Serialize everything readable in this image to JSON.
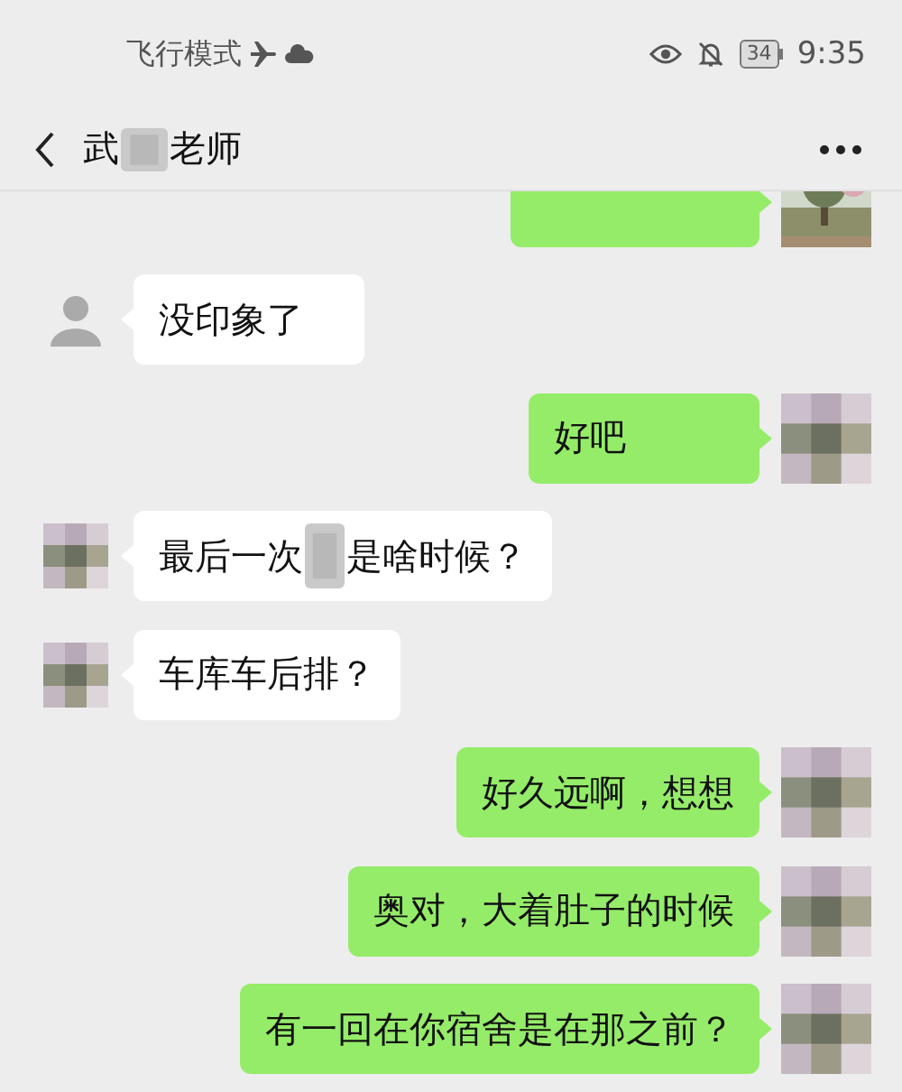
{
  "status_bar": {
    "mode_text": "飞行模式",
    "battery": "34",
    "time": "9:35"
  },
  "header": {
    "title_parts": [
      "武",
      "老师"
    ]
  },
  "messages": [
    {
      "kind": "sent"
    },
    {
      "kind": "received",
      "avatar": {
        "kind": "person"
      },
      "parts": [
        "没印象了"
      ]
    },
    {
      "kind": "sent",
      "avatar": {
        "kind": "blurred"
      },
      "parts": [
        "好吧"
      ]
    },
    {
      "kind": "received",
      "avatar": {
        "kind": "blurred"
      },
      "parts": [
        "最后一次",
        "是啥时候？"
      ]
    },
    {
      "kind": "received",
      "avatar": {
        "kind": "blurred"
      },
      "parts": [
        "车库车后排？"
      ]
    },
    {
      "kind": "sent",
      "avatar": {
        "kind": "blurred"
      },
      "parts": [
        "好久远啊，想想"
      ]
    },
    {
      "kind": "sent",
      "avatar": {
        "kind": "blurred"
      },
      "parts": [
        "奥对，大着肚子的时候"
      ]
    },
    {
      "kind": "sent",
      "avatar": {
        "kind": "blurred"
      },
      "parts": [
        "有一回在你宿舍是在那之前？"
      ]
    }
  ]
}
